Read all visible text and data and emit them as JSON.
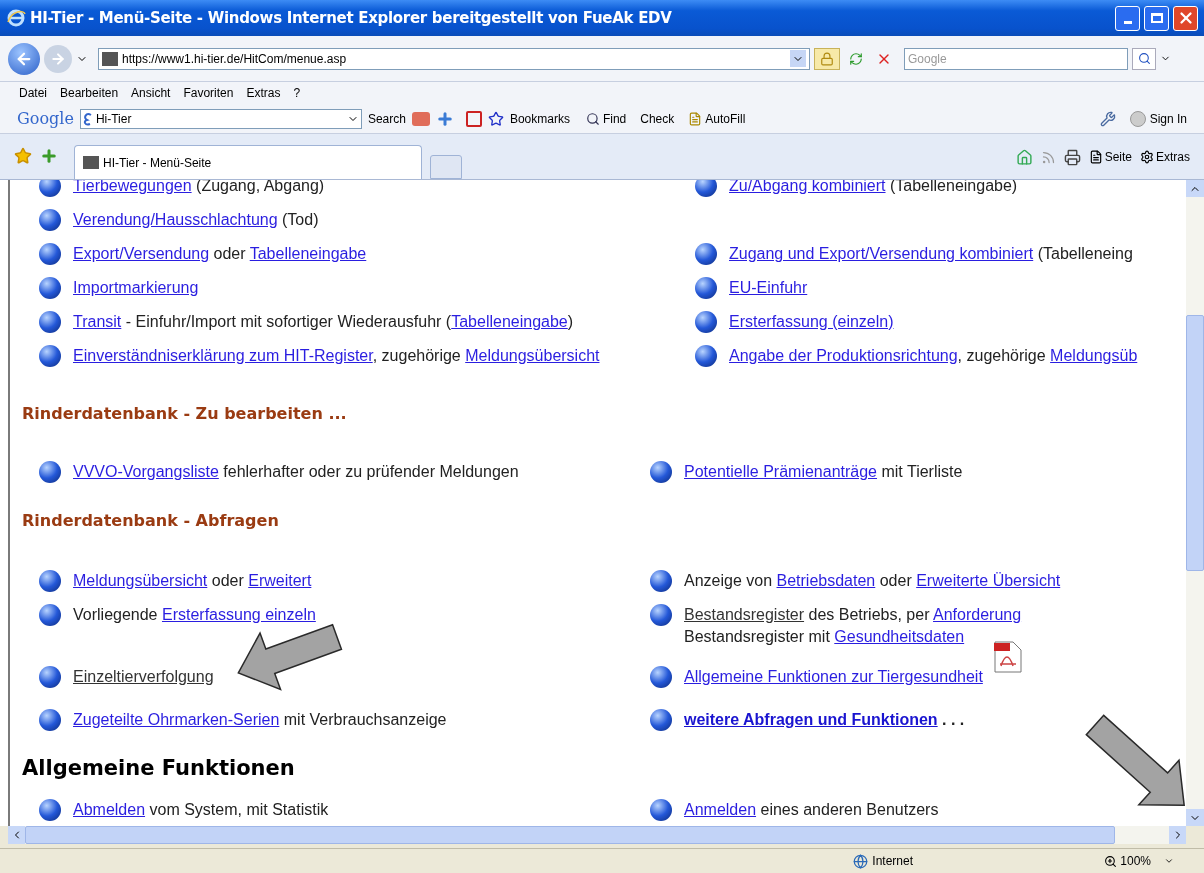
{
  "window": {
    "title": "HI-Tier - Menü-Seite - Windows Internet Explorer bereitgestellt von FueAk EDV"
  },
  "address_bar": {
    "url": "https://www1.hi-tier.de/HitCom/menue.asp"
  },
  "search_field": {
    "placeholder": "Google"
  },
  "menu_bar": [
    "Datei",
    "Bearbeiten",
    "Ansicht",
    "Favoriten",
    "Extras",
    "?"
  ],
  "google_toolbar": {
    "logo": "Google",
    "query": "Hi-Tier",
    "search": "Search",
    "bookmarks": "Bookmarks",
    "find": "Find",
    "check": "Check",
    "autofill": "AutoFill",
    "sign_in": "Sign In"
  },
  "tabs": [
    {
      "label": "HI-Tier - Menü-Seite",
      "selected": true
    }
  ],
  "command_bar": {
    "page": "Seite",
    "tools": "Extras"
  },
  "sections": [
    {
      "rows": [
        {
          "left": {
            "parts": [
              {
                "kind": "link",
                "text": "Tierbewegungen"
              },
              {
                "kind": "text",
                "text": " (Zugang, Abgang)"
              }
            ]
          },
          "right": {
            "parts": [
              {
                "kind": "link",
                "text": "Zu/Abgang kombiniert"
              },
              {
                "kind": "text",
                "text": " (Tabelleneingabe)"
              }
            ]
          }
        },
        {
          "left": {
            "parts": [
              {
                "kind": "link",
                "text": "Verendung/Hausschlachtung"
              },
              {
                "kind": "text",
                "text": " (Tod)"
              }
            ]
          },
          "right": null
        },
        {
          "left": {
            "parts": [
              {
                "kind": "link",
                "text": "Export/Versendung"
              },
              {
                "kind": "text",
                "text": " oder "
              },
              {
                "kind": "link",
                "text": "Tabelleneingabe"
              }
            ]
          },
          "right": {
            "parts": [
              {
                "kind": "link",
                "text": "Zugang und Export/Versendung kombiniert"
              },
              {
                "kind": "text",
                "text": " (Tabelleneing"
              }
            ]
          }
        },
        {
          "left": {
            "parts": [
              {
                "kind": "link",
                "text": "Importmarkierung"
              }
            ]
          },
          "right": {
            "parts": [
              {
                "kind": "link",
                "text": "EU-Einfuhr"
              }
            ]
          }
        },
        {
          "left": {
            "parts": [
              {
                "kind": "link",
                "text": "Transit"
              },
              {
                "kind": "text",
                "text": " - Einfuhr/Import mit sofortiger Wiederausfuhr ("
              },
              {
                "kind": "link",
                "text": "Tabelleneingabe"
              },
              {
                "kind": "text",
                "text": ")"
              }
            ]
          },
          "right": {
            "parts": [
              {
                "kind": "link",
                "text": "Ersterfassung (einzeln)"
              }
            ]
          }
        },
        {
          "left": {
            "parts": [
              {
                "kind": "link",
                "text": "Einverständniserklärung zum HIT-Register"
              },
              {
                "kind": "text",
                "text": ", zugehörige "
              },
              {
                "kind": "link",
                "text": "Meldungsübersicht"
              }
            ]
          },
          "right": {
            "parts": [
              {
                "kind": "link",
                "text": "Angabe der Produktionsrichtung"
              },
              {
                "kind": "text",
                "text": ", zugehörige "
              },
              {
                "kind": "link",
                "text": "Meldungsüb"
              }
            ]
          }
        }
      ]
    },
    {
      "heading": {
        "kind": "section",
        "text": "Rinderdatenbank - Zu bearbeiten ..."
      },
      "rows": [
        {
          "left": {
            "parts": [
              {
                "kind": "link",
                "text": "VVVO-Vorgangsliste"
              },
              {
                "kind": "text",
                "text": " fehlerhafter oder zu prüfender Meldungen"
              }
            ]
          },
          "right": {
            "parts": [
              {
                "kind": "link",
                "text": "Potentielle Prämienanträge"
              },
              {
                "kind": "text",
                "text": " mit Tierliste"
              }
            ]
          }
        }
      ]
    },
    {
      "heading": {
        "kind": "section",
        "text": "Rinderdatenbank - Abfragen"
      },
      "rows": [
        {
          "left": {
            "parts": [
              {
                "kind": "link",
                "text": "Meldungsübersicht"
              },
              {
                "kind": "text",
                "text": " oder "
              },
              {
                "kind": "link",
                "text": "Erweitert"
              }
            ]
          },
          "right": {
            "parts": [
              {
                "kind": "text",
                "text": "Anzeige von "
              },
              {
                "kind": "link",
                "text": "Betriebsdaten"
              },
              {
                "kind": "text",
                "text": " oder "
              },
              {
                "kind": "link",
                "text": "Erweiterte Übersicht"
              }
            ]
          }
        },
        {
          "left": {
            "parts": [
              {
                "kind": "text",
                "text": "Vorliegende "
              },
              {
                "kind": "link",
                "text": "Ersterfassung einzeln"
              }
            ]
          },
          "right": {
            "parts": [
              {
                "kind": "visited_link",
                "text": "Bestandsregister"
              },
              {
                "kind": "text",
                "text": " des Betriebs, per "
              },
              {
                "kind": "link",
                "text": "Anforderung"
              }
            ],
            "line2": [
              {
                "kind": "text",
                "text": "Bestandsregister mit "
              },
              {
                "kind": "link",
                "text": "Gesundheitsdaten"
              }
            ]
          }
        },
        {
          "left": {
            "parts": [
              {
                "kind": "visited_link",
                "text": "Einzeltierverfolgung"
              }
            ]
          },
          "right": {
            "parts": [
              {
                "kind": "link",
                "text": "Allgemeine Funktionen zur Tiergesundheit"
              }
            ],
            "document_icon": true
          }
        },
        {
          "left": {
            "parts": [
              {
                "kind": "link",
                "text": "Zugeteilte Ohrmarken-Serien"
              },
              {
                "kind": "text",
                "text": " mit Verbrauchsanzeige"
              }
            ]
          },
          "right": {
            "parts": [
              {
                "kind": "bold_link",
                "text": "weitere Abfragen und Funktionen"
              },
              {
                "kind": "bold_text",
                "text": " . . ."
              }
            ]
          }
        }
      ]
    },
    {
      "heading": {
        "kind": "page",
        "text": "Allgemeine Funktionen"
      },
      "rows": [
        {
          "left": {
            "parts": [
              {
                "kind": "link",
                "text": "Abmelden"
              },
              {
                "kind": "text",
                "text": " vom System, mit Statistik"
              }
            ]
          },
          "right": {
            "parts": [
              {
                "kind": "link",
                "text": "Anmelden"
              },
              {
                "kind": "text",
                "text": " eines anderen Benutzers"
              }
            ]
          }
        }
      ]
    }
  ],
  "status_bar": {
    "zone": "Internet",
    "zoom": "100%"
  }
}
